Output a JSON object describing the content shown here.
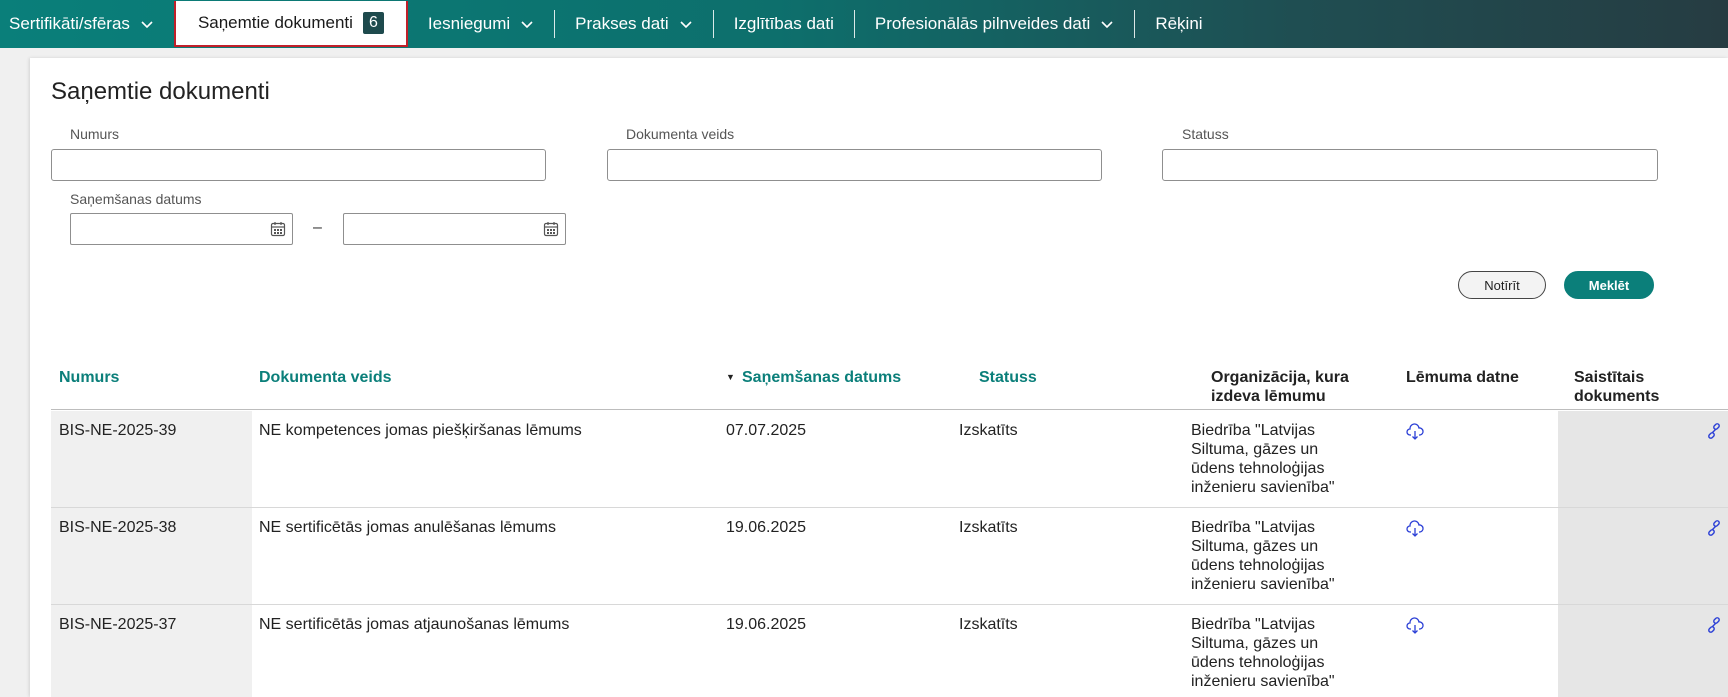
{
  "nav": {
    "items": [
      {
        "label": "Sertifikāti/sfēras"
      },
      {
        "label": "Saņemtie dokumenti",
        "badge": "6"
      },
      {
        "label": "Iesniegumi"
      },
      {
        "label": "Prakses dati"
      },
      {
        "label": "Izglītības dati"
      },
      {
        "label": "Profesionālās pilnveides dati"
      },
      {
        "label": "Rēķini"
      }
    ]
  },
  "page": {
    "title": "Saņemtie dokumenti"
  },
  "filters": {
    "number_label": "Numurs",
    "number_value": "",
    "doc_type_label": "Dokumenta veids",
    "doc_type_value": "",
    "status_label": "Statuss",
    "status_value": "",
    "date_label": "Saņemšanas datums",
    "date_from": "",
    "date_to": "",
    "date_separator": "–",
    "clear_label": "Notīrīt",
    "search_label": "Meklēt"
  },
  "table": {
    "headers": [
      "Numurs",
      "Dokumenta veids",
      "Saņemšanas datums",
      "Statuss",
      "Organizācija, kura izdeva lēmumu",
      "Lēmuma datne",
      "Saistītais dokuments"
    ],
    "rows": [
      {
        "number": "BIS-NE-2025-39",
        "type": "NE kompetences jomas piešķiršanas lēmums",
        "date": "07.07.2025",
        "status": "Izskatīts",
        "org": "Biedrība \"Latvijas Siltuma, gāzes un ūdens tehnoloģijas inženieru savienība\""
      },
      {
        "number": "BIS-NE-2025-38",
        "type": "NE sertificētās jomas anulēšanas lēmums",
        "date": "19.06.2025",
        "status": "Izskatīts",
        "org": "Biedrība \"Latvijas Siltuma, gāzes un ūdens tehnoloģijas inženieru savienība\""
      },
      {
        "number": "BIS-NE-2025-37",
        "type": "NE sertificētās jomas atjaunošanas lēmums",
        "date": "19.06.2025",
        "status": "Izskatīts",
        "org": "Biedrība \"Latvijas Siltuma, gāzes un ūdens tehnoloģijas inženieru savienība\""
      }
    ]
  },
  "colors": {
    "accent": "#0b7f7a",
    "highlight_border": "#c0202a",
    "icon_blue": "#2b3fd6"
  }
}
